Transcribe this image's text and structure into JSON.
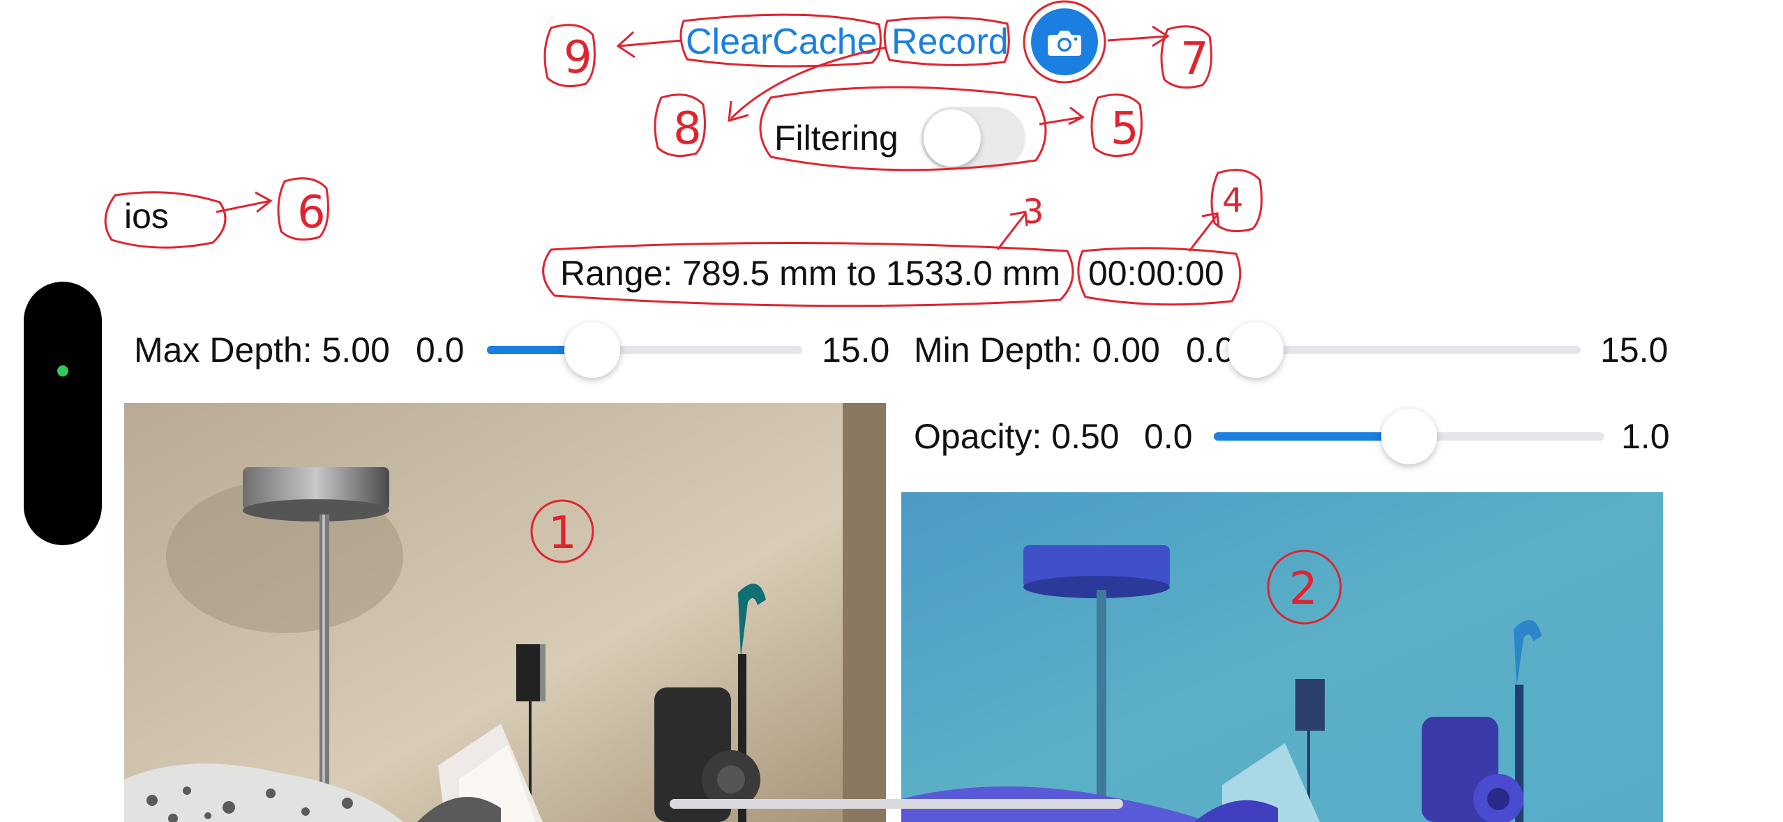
{
  "toolbar": {
    "clear_cache_label": "ClearCache",
    "record_label": "Record",
    "camera_icon": "camera-icon"
  },
  "filtering": {
    "label": "Filtering",
    "enabled": false
  },
  "platform_label": "ios",
  "status": {
    "range_text": "Range: 789.5 mm to 1533.0 mm",
    "timer_text": "00:00:00"
  },
  "sliders": {
    "max_depth": {
      "label": "Max Depth: 5.00",
      "min_label": "0.0",
      "max_label": "15.0",
      "value": 5.0,
      "min": 0.0,
      "max": 15.0
    },
    "min_depth": {
      "label": "Min Depth: 0.00",
      "min_label": "0.0",
      "max_label": "15.0",
      "value": 0.0,
      "min": 0.0,
      "max": 15.0
    },
    "opacity": {
      "label": "Opacity: 0.50",
      "min_label": "0.0",
      "max_label": "1.0",
      "value": 0.5,
      "min": 0.0,
      "max": 1.0
    }
  },
  "annotations": [
    "9",
    "8",
    "7",
    "5",
    "6",
    "3",
    "4",
    "1",
    "2"
  ],
  "colors": {
    "accent": "#1a7fe0",
    "annotation": "#e0242f",
    "status_dot": "#34c759"
  }
}
